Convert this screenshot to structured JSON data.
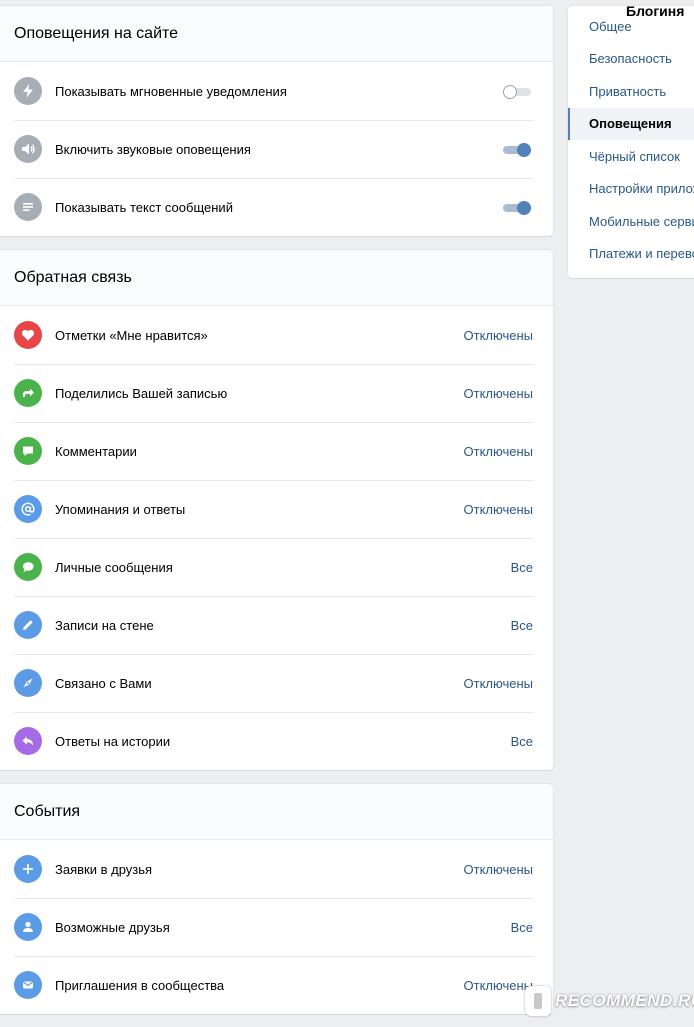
{
  "sections": [
    {
      "title": "Оповещения на сайте",
      "rows": [
        {
          "label": "Показывать мгновенные уведомления",
          "icon": "lightning-icon",
          "color": "#a7adb4",
          "toggle": "off"
        },
        {
          "label": "Включить звуковые оповещения",
          "icon": "speaker-icon",
          "color": "#a7adb4",
          "toggle": "on"
        },
        {
          "label": "Показывать текст сообщений",
          "icon": "text-lines-icon",
          "color": "#a7adb4",
          "toggle": "on"
        }
      ]
    },
    {
      "title": "Обратная связь",
      "rows": [
        {
          "label": "Отметки «Мне нравится»",
          "icon": "heart-icon",
          "color": "#e64646",
          "value": "Отключены"
        },
        {
          "label": "Поделились Вашей записью",
          "icon": "share-icon",
          "color": "#4bb34b",
          "value": "Отключены"
        },
        {
          "label": "Комментарии",
          "icon": "comment-icon",
          "color": "#4bb34b",
          "value": "Отключены"
        },
        {
          "label": "Упоминания и ответы",
          "icon": "at-icon",
          "color": "#5c9ce6",
          "value": "Отключены"
        },
        {
          "label": "Личные сообщения",
          "icon": "message-icon",
          "color": "#4bb34b",
          "value": "Все"
        },
        {
          "label": "Записи на стене",
          "icon": "pencil-icon",
          "color": "#5c9ce6",
          "value": "Все"
        },
        {
          "label": "Связано с Вами",
          "icon": "compass-icon",
          "color": "#5c9ce6",
          "value": "Отключены"
        },
        {
          "label": "Ответы на истории",
          "icon": "reply-icon",
          "color": "#a56ae6",
          "value": "Все"
        }
      ]
    },
    {
      "title": "События",
      "rows": [
        {
          "label": "Заявки в друзья",
          "icon": "plus-icon",
          "color": "#5c9ce6",
          "value": "Отключены"
        },
        {
          "label": "Возможные друзья",
          "icon": "person-icon",
          "color": "#5c9ce6",
          "value": "Все"
        },
        {
          "label": "Приглашения в сообщества",
          "icon": "envelope-icon",
          "color": "#5c9ce6",
          "value": "Отключены"
        }
      ]
    }
  ],
  "menu": {
    "top_label": "Блогиня",
    "items": [
      {
        "label": "Общее",
        "active": false
      },
      {
        "label": "Безопасность",
        "active": false
      },
      {
        "label": "Приватность",
        "active": false
      },
      {
        "label": "Оповещения",
        "active": true
      },
      {
        "label": "Чёрный список",
        "active": false
      },
      {
        "label": "Настройки приложений",
        "active": false
      },
      {
        "label": "Мобильные сервисы",
        "active": false
      },
      {
        "label": "Платежи и переводы",
        "active": false
      }
    ]
  },
  "watermark": "RECOMMEND.RU"
}
